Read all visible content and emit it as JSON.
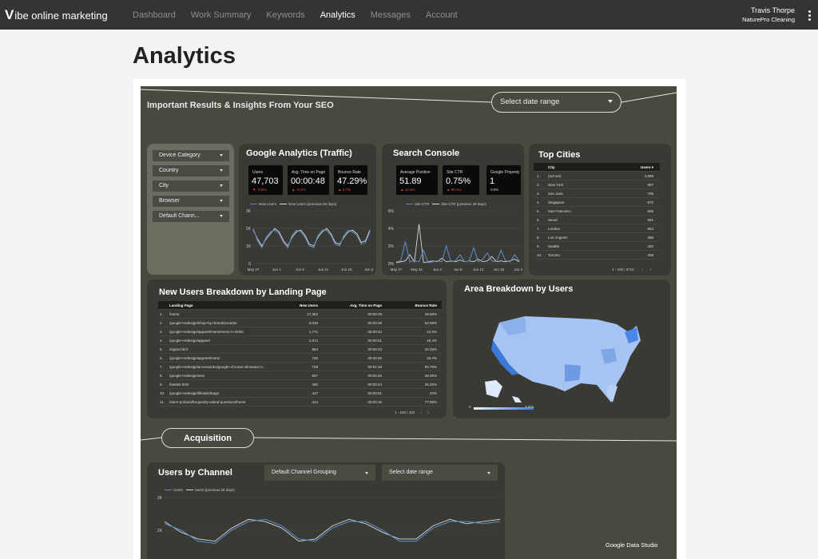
{
  "nav": {
    "logo_v": "V",
    "logo_rest": "ibe online marketing",
    "items": [
      {
        "label": "Dashboard"
      },
      {
        "label": "Work Summary"
      },
      {
        "label": "Keywords"
      },
      {
        "label": "Analytics"
      },
      {
        "label": "Messages"
      },
      {
        "label": "Account"
      }
    ],
    "active": "Analytics",
    "user_name": "Travis Thorpe",
    "user_company": "NaturePro Cleaning"
  },
  "page": {
    "title": "Analytics"
  },
  "dashboard": {
    "header_title": "Important Results & Insights From Your SEO",
    "date_range": "Select date range",
    "filters": [
      "Device Category",
      "Country",
      "City",
      "Browser",
      "Default Chann..."
    ],
    "ga": {
      "title": "Google Analytics (Traffic)",
      "kpis": [
        {
          "label": "Users",
          "value": "47,703",
          "change": "▼ -5.5%"
        },
        {
          "label": "Avg. Time on Page",
          "value": "00:00:48",
          "change": "▲ -4.2%"
        },
        {
          "label": "Bounce Rate",
          "value": "47.29%",
          "change": "▲ 2.7%"
        }
      ],
      "legend": [
        "New Users",
        "New Users (previous 28 days)"
      ],
      "y_ticks": [
        "3K",
        "2K",
        "1K",
        "0"
      ],
      "x_ticks": [
        "May 27",
        "Jun 1",
        "Jun 6",
        "Jun 11",
        "Jun 16",
        "Jun 21"
      ],
      "series_current": [
        2.0,
        1.3,
        0.9,
        1.5,
        1.8,
        1.9,
        1.7,
        1.2,
        0.9,
        1.6,
        1.9,
        1.8,
        1.5,
        1.0,
        0.9,
        1.6,
        1.9,
        1.9,
        1.6,
        1.1,
        1.0,
        1.6,
        1.9,
        1.8,
        1.6,
        1.1,
        1.2,
        1.8
      ],
      "series_previous": [
        1.9,
        1.4,
        1.0,
        1.4,
        1.7,
        2.0,
        1.8,
        1.3,
        1.0,
        1.5,
        1.8,
        1.9,
        1.6,
        1.1,
        1.0,
        1.5,
        1.8,
        2.0,
        1.7,
        1.2,
        1.1,
        1.5,
        1.8,
        1.9,
        1.7,
        1.2,
        1.3,
        1.9
      ],
      "ymax": 3
    },
    "sc": {
      "title": "Search Console",
      "kpis": [
        {
          "label": "Average Position",
          "value": "51.89",
          "change": "▲ 12.3%"
        },
        {
          "label": "Site CTR",
          "value": "0.75%",
          "change": "▲ 99.1%"
        },
        {
          "label": "Google Property",
          "value": "1",
          "change": "0.0%"
        }
      ],
      "legend": [
        "Site CTR",
        "Site CTR (previous 28 days)"
      ],
      "y_ticks": [
        "6%",
        "4%",
        "2%",
        "0%"
      ],
      "x_ticks": [
        "May 27",
        "May 31",
        "Jun 4",
        "Jun 8",
        "Jun 12",
        "Jun 16",
        "Jun 20"
      ],
      "series_current": [
        0.2,
        0.3,
        2.5,
        0.2,
        0.3,
        0.2,
        1.5,
        0.1,
        0.2,
        0.3,
        0.2,
        2.0,
        0.2,
        0.3,
        1.0,
        0.2,
        0.3,
        1.8,
        0.2,
        0.5,
        1.2,
        0.3,
        0.2,
        1.5,
        0.3,
        0.2,
        1.0,
        0.3
      ],
      "series_previous": [
        0.1,
        0.2,
        0.3,
        1.0,
        0.2,
        4.5,
        0.1,
        0.2,
        0.3,
        0.2,
        0.6,
        0.2,
        0.3,
        0.2,
        0.4,
        0.2,
        0.3,
        0.2,
        0.5,
        0.2,
        0.3,
        0.8,
        0.2,
        0.3,
        0.2,
        0.3,
        0.5,
        0.2
      ],
      "ymax": 6
    },
    "cities": {
      "title": "Top Cities",
      "headers": [
        "City",
        "Users ▾"
      ],
      "rows": [
        [
          "1.",
          "(not set)",
          "3,899"
        ],
        [
          "2.",
          "New York",
          "997"
        ],
        [
          "3.",
          "San Jose",
          "705"
        ],
        [
          "4.",
          "Singapore",
          "670"
        ],
        [
          "5.",
          "San Francisco",
          "655"
        ],
        [
          "6.",
          "Seoul",
          "591"
        ],
        [
          "7.",
          "London",
          "554"
        ],
        [
          "8.",
          "Los Angeles",
          "488"
        ],
        [
          "9.",
          "Seattle",
          "420"
        ],
        [
          "10.",
          "Toronto",
          "408"
        ]
      ],
      "pager": "1 - 100 / 6710"
    },
    "landing": {
      "title": "New Users Breakdown by Landing Page",
      "headers": [
        "Landing Page",
        "New Users",
        "Avg. Time on Page",
        "Bounce Rate"
      ],
      "rows": [
        [
          "1.",
          "/home",
          "27,352",
          "00:00:49",
          "49.69%"
        ],
        [
          "2.",
          "/google+redesign/shop+by+brand/youtube",
          "3,026",
          "00:00:28",
          "53.08%"
        ],
        [
          "3.",
          "/google+redesign/apparel/mens/mens+t+shirts",
          "1,771",
          "00:00:42",
          "41.5%"
        ],
        [
          "4.",
          "/google+redesign/apparel",
          "1,074",
          "00:00:51",
          "40.4%"
        ],
        [
          "5.",
          "/signin.html",
          "864",
          "00:00:43",
          "20.25%"
        ],
        [
          "6.",
          "/google+redesign/apparel/mens",
          "746",
          "00:00:45",
          "33.4%"
        ],
        [
          "7.",
          "/google+redesign/accessories/google+chrome+dinosaur+c...",
          "728",
          "00:01:18",
          "83.76%"
        ],
        [
          "8.",
          "/google+redesign/new",
          "567",
          "00:00:45",
          "38.05%"
        ],
        [
          "9.",
          "/basket.html",
          "460",
          "00:00:44",
          "35.25%"
        ],
        [
          "10.",
          "/google+redesign/lifestyle/bags",
          "447",
          "00:00:51",
          "40%"
        ],
        [
          "11.",
          "/store-policies/frequently-asked-questions/home",
          "444",
          "00:00:16",
          "77.59%"
        ]
      ],
      "pager": "1 - 100 / 442"
    },
    "area": {
      "title": "Area Breakdown by Users",
      "scale_min": "0",
      "scale_max": "3,905"
    },
    "acquisition_label": "Acquisition",
    "channel": {
      "title": "Users by Channel",
      "dropdown_grouping": "Default Channel Grouping",
      "dropdown_date": "Select date range",
      "legend": [
        "Users",
        "Users (previous 28 days)"
      ],
      "y_ticks": [
        "3K",
        "2K",
        "1K"
      ],
      "series_current": [
        1.8,
        1.5,
        1.0,
        0.9,
        1.5,
        1.9,
        2.0,
        1.7,
        1.1,
        1.0,
        1.6,
        1.9,
        1.9,
        1.5,
        1.0,
        1.0,
        1.6,
        1.9,
        1.9,
        1.8,
        1.9
      ],
      "series_previous": [
        1.9,
        1.4,
        1.1,
        1.0,
        1.6,
        2.0,
        1.9,
        1.6,
        1.0,
        1.1,
        1.7,
        2.0,
        1.8,
        1.4,
        1.1,
        1.1,
        1.7,
        2.0,
        1.8,
        1.9,
        2.0
      ],
      "ymax": 3
    },
    "watermark": "Google Data Studio"
  },
  "colors": {
    "dash_bg": "#474a3e",
    "card_bg": "#393a33",
    "series_current": "#5d87c7",
    "series_previous": "#d9d9d9"
  }
}
